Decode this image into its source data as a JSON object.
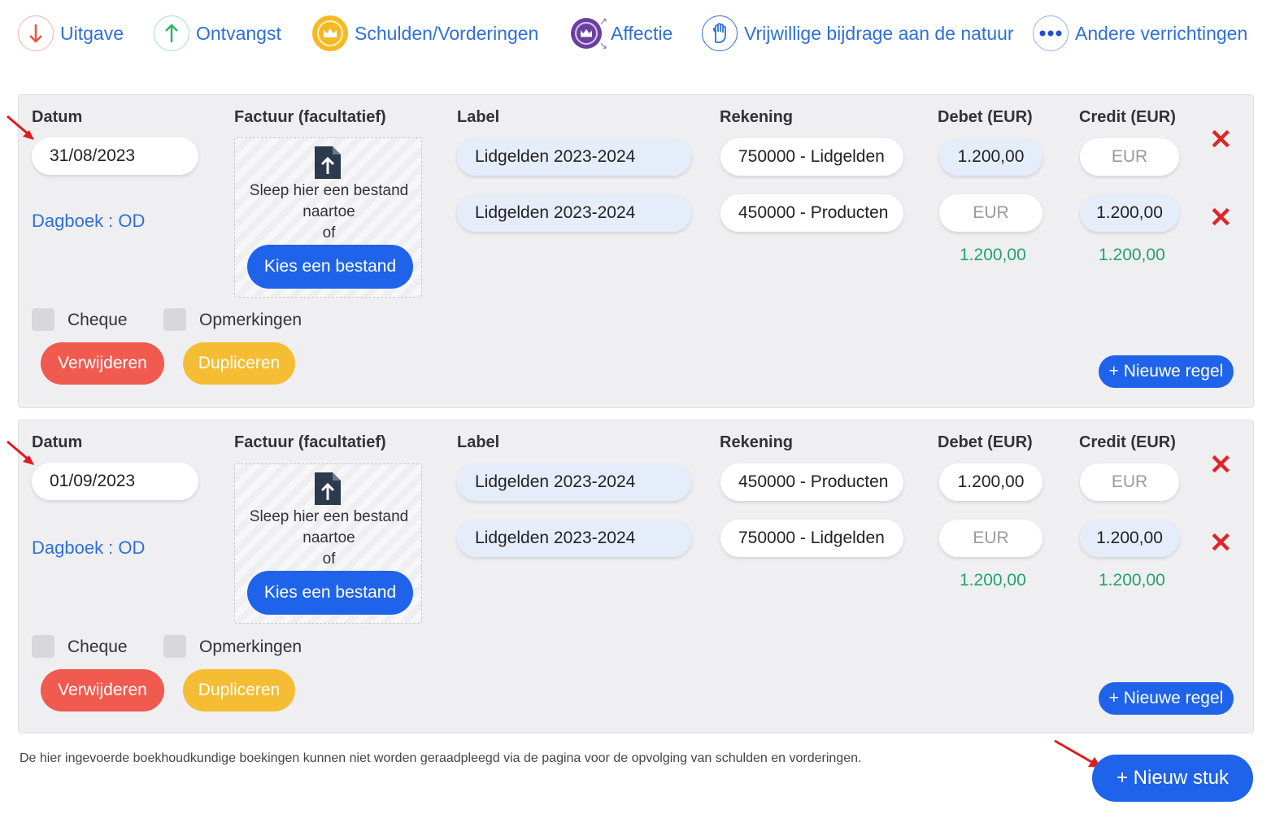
{
  "nav": {
    "items": [
      {
        "label": "Uitgave",
        "icon": "arrow-down-icon",
        "color": "#e8553d"
      },
      {
        "label": "Ontvangst",
        "icon": "arrow-up-icon",
        "color": "#2fb36a"
      },
      {
        "label": "Schulden/Vorderingen",
        "icon": "crown-icon",
        "color": "#f4b923"
      },
      {
        "label": "Affectie",
        "icon": "crown-transfer-icon",
        "color": "#6b3fa0"
      },
      {
        "label": "Vrijwillige bijdrage aan de natuur",
        "icon": "hand-icon",
        "color": "#2f6fd8"
      },
      {
        "label": "Andere verrichtingen",
        "icon": "more-dots-icon",
        "color": "#1e4fd0"
      }
    ]
  },
  "headers": {
    "date": "Datum",
    "invoice": "Factuur (facultatief)",
    "label": "Label",
    "account": "Rekening",
    "debit": "Debet (EUR)",
    "credit": "Credit (EUR)"
  },
  "common": {
    "journal": "Dagboek : OD",
    "dropzone_text_1": "Sleep hier een bestand",
    "dropzone_text_2": "naartoe",
    "dropzone_text_3": "of",
    "choose_file": "Kies een bestand",
    "cheque": "Cheque",
    "remarks": "Opmerkingen",
    "delete": "Verwijderen",
    "duplicate": "Dupliceren",
    "new_line": "+ Nieuwe regel",
    "amount_placeholder": "EUR",
    "remove_line_glyph": "✕"
  },
  "entries": [
    {
      "date": "31/08/2023",
      "lines": [
        {
          "label": "Lidgelden 2023-2024",
          "account": "750000 - Lidgelden",
          "debit": "1.200,00",
          "credit": ""
        },
        {
          "label": "Lidgelden 2023-2024",
          "account": "450000 - Producten",
          "debit": "",
          "credit": "1.200,00"
        }
      ],
      "total_debit": "1.200,00",
      "total_credit": "1.200,00"
    },
    {
      "date": "01/09/2023",
      "lines": [
        {
          "label": "Lidgelden 2023-2024",
          "account": "450000 - Producten",
          "debit": "1.200,00",
          "credit": ""
        },
        {
          "label": "Lidgelden 2023-2024",
          "account": "750000 - Lidgelden",
          "debit": "",
          "credit": "1.200,00"
        }
      ],
      "total_debit": "1.200,00",
      "total_credit": "1.200,00"
    }
  ],
  "footer": {
    "note": "De hier ingevoerde boekhoudkundige boekingen kunnen niet worden geraadpleegd via de pagina voor de opvolging van schulden en vorderingen.",
    "new_document": "+ Nieuw stuk"
  },
  "colors": {
    "primary": "#1e63e9",
    "danger": "#f05a4f",
    "warning": "#f4bd34",
    "total": "#23a26b",
    "annotation_arrow": "#e01b1b"
  }
}
